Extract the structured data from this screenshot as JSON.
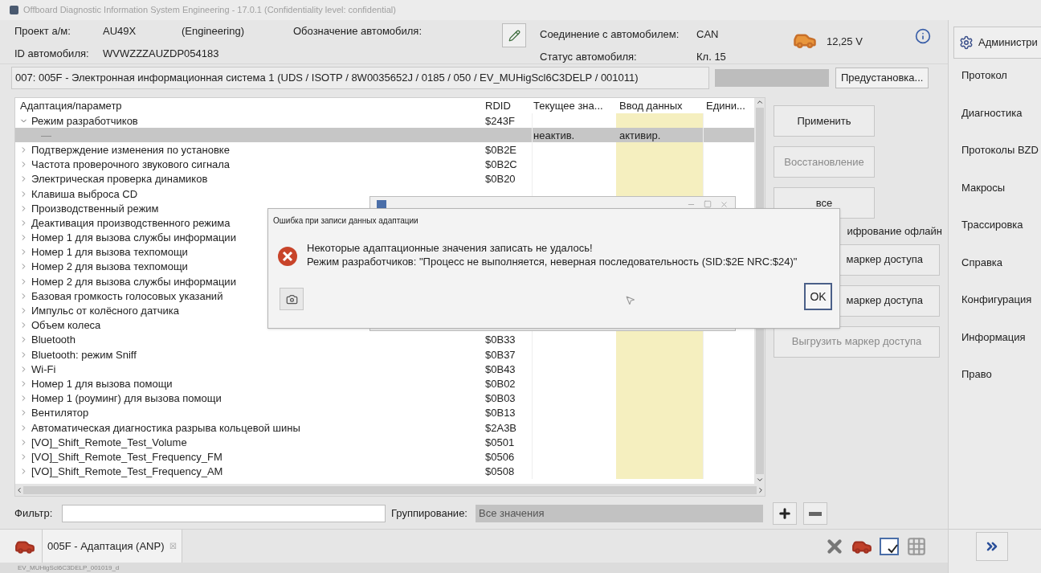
{
  "window": {
    "title": "Offboard Diagnostic Information System Engineering - 17.0.1 (Confidentiality level: confidential)"
  },
  "header": {
    "project_label": "Проект а/м:",
    "project_value": "AU49X",
    "project_mode": "(Engineering)",
    "designation_label": "Обозначение автомобиля:",
    "vin_label": "ID автомобиля:",
    "vin_value": "WVWZZZAUZDP054183",
    "connection_label": "Соединение с автомобилем:",
    "connection_value": "CAN",
    "status_label": "Статус автомобиля:",
    "status_value": "Кл. 15",
    "voltage": "12,25 V"
  },
  "module": {
    "text": "007: 005F - Электронная информационная система 1  (UDS / ISOTP / 8W0035652J / 0185 / 050 / EV_MUHigScl6C3DELP / 001011)",
    "preset_button": "Предустановка..."
  },
  "table": {
    "columns": [
      "Адаптация/параметр",
      "RDID",
      "Текущее зна...",
      "Ввод данных",
      "Едини..."
    ],
    "rows": [
      {
        "name": "Режим разработчиков",
        "rdid": "$243F",
        "expanded": true,
        "selected": false,
        "children": [
          {
            "name": "—",
            "current": "неактив.",
            "input": "активир.",
            "selected": true
          }
        ]
      },
      {
        "name": "Подтверждение изменения по установке",
        "rdid": "$0B2E",
        "expanded": false,
        "selected": false
      },
      {
        "name": "Частота проверочного звукового сигнала",
        "rdid": "$0B2C",
        "expanded": false,
        "selected": false
      },
      {
        "name": "Электрическая проверка динамиков",
        "rdid": "$0B20",
        "expanded": false,
        "selected": false
      },
      {
        "name": "Клавиша выброса CD",
        "expanded": false,
        "selected": false
      },
      {
        "name": "Производственный режим",
        "expanded": false,
        "selected": false
      },
      {
        "name": "Деактивация производственного режима",
        "expanded": false,
        "selected": false
      },
      {
        "name": "Номер 1 для вызова службы информации",
        "expanded": false,
        "selected": false
      },
      {
        "name": "Номер 1 для вызова техпомощи",
        "expanded": false,
        "selected": false
      },
      {
        "name": "Номер 2 для вызова техпомощи",
        "expanded": false,
        "selected": false
      },
      {
        "name": "Номер 2 для вызова службы информации",
        "expanded": false,
        "selected": false
      },
      {
        "name": "Базовая громкость голосовых указаний",
        "expanded": false,
        "selected": false
      },
      {
        "name": "Импульс от колёсного датчика",
        "expanded": false,
        "selected": false
      },
      {
        "name": "Объем колеса",
        "expanded": false,
        "selected": false
      },
      {
        "name": "Bluetooth",
        "rdid": "$0B33",
        "expanded": false,
        "selected": false
      },
      {
        "name": "Bluetooth: режим Sniff",
        "rdid": "$0B37",
        "expanded": false,
        "selected": false
      },
      {
        "name": "Wi-Fi",
        "rdid": "$0B43",
        "expanded": false,
        "selected": false
      },
      {
        "name": "Номер 1 для вызова помощи",
        "rdid": "$0B02",
        "expanded": false,
        "selected": false
      },
      {
        "name": "Номер 1 (роуминг) для вызова помощи",
        "rdid": "$0B03",
        "expanded": false,
        "selected": false
      },
      {
        "name": "Вентилятор",
        "rdid": "$0B13",
        "expanded": false,
        "selected": false
      },
      {
        "name": "Автоматическая диагностика разрыва кольцевой шины",
        "rdid": "$2A3B",
        "expanded": false,
        "selected": false
      },
      {
        "name": "[VO]_Shift_Remote_Test_Volume",
        "rdid": "$0501",
        "expanded": false,
        "selected": false
      },
      {
        "name": "[VO]_Shift_Remote_Test_Frequency_FM",
        "rdid": "$0506",
        "expanded": false,
        "selected": false
      },
      {
        "name": "[VO]_Shift_Remote_Test_Frequency_AM",
        "rdid": "$0508",
        "expanded": false,
        "selected": false
      }
    ]
  },
  "actions": [
    {
      "kind": "button",
      "label": "Применить",
      "disabled": false
    },
    {
      "kind": "button",
      "label": "Восстановление",
      "disabled": true
    },
    {
      "kind": "button",
      "label": "все",
      "disabled": false
    },
    {
      "kind": "label",
      "label": "ифрование офлайн"
    },
    {
      "kind": "button",
      "label": "маркер доступа",
      "disabled": false
    },
    {
      "kind": "button",
      "label": "маркер доступа",
      "disabled": false
    },
    {
      "kind": "button",
      "label": "Выгрузить маркер доступа",
      "disabled": true
    }
  ],
  "filter": {
    "label": "Фильтр:",
    "grouping_label": "Группирование:",
    "grouping_value": "Все значения"
  },
  "tab": {
    "label": "005F - Адаптация (ANP)",
    "close": "☒"
  },
  "status_bar": "EV_MUHigScl6C3DELP_001019_d",
  "sidebar": {
    "top_button": "Администри",
    "items": [
      "Протокол",
      "Диагностика",
      "Протоколы BZD",
      "Макросы",
      "Трассировка",
      "Справка",
      "Конфигурация",
      "Информация",
      "Право"
    ]
  },
  "error_dialog": {
    "title": "Ошибка при записи данных адаптации",
    "lines": [
      "Некоторые адаптационные значения записать не удалось!",
      "Режим разработчиков: \"Процесс не выполняется, неверная последовательность (SID:$2E NRC:$24)\""
    ],
    "ok": "OK"
  }
}
